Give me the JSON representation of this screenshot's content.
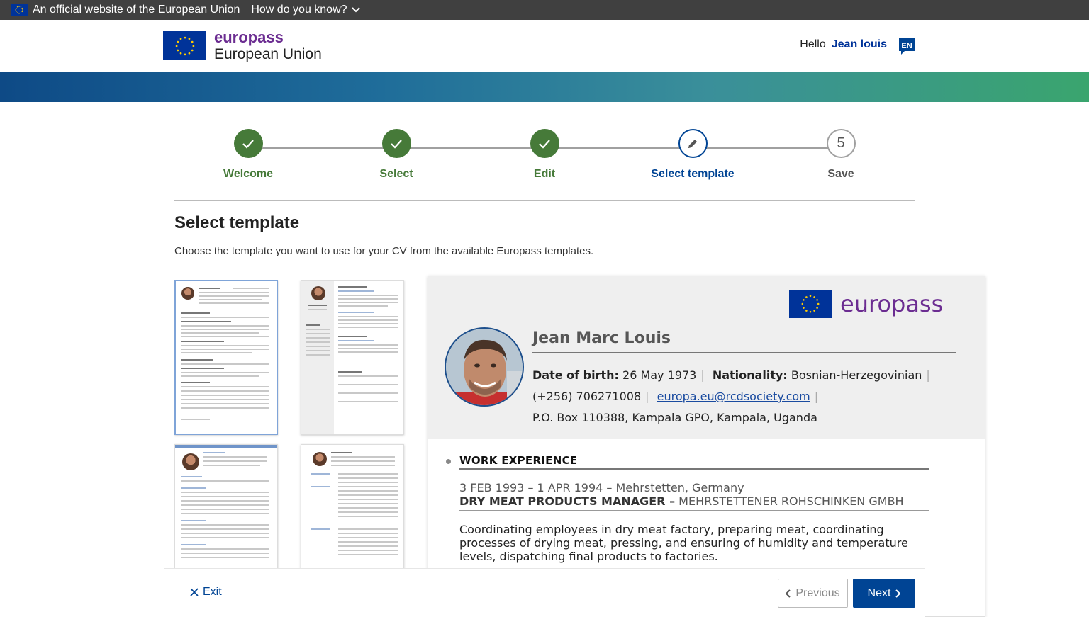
{
  "eu_bar": {
    "official_text": "An official website of the European Union",
    "how_know": "How do you know?"
  },
  "header": {
    "brand": "europass",
    "org": "European Union",
    "greeting": "Hello",
    "user_name": "Jean louis",
    "language": "EN"
  },
  "stepper": {
    "steps": [
      {
        "label": "Welcome",
        "state": "done"
      },
      {
        "label": "Select",
        "state": "done"
      },
      {
        "label": "Edit",
        "state": "done"
      },
      {
        "label": "Select template",
        "state": "current"
      },
      {
        "label": "Save",
        "state": "todo",
        "number": "5"
      }
    ]
  },
  "page": {
    "title": "Select template",
    "intro": "Choose the template you want to use for your CV from the available Europass templates."
  },
  "preview": {
    "brand": "europass",
    "name": "Jean Marc Louis",
    "dob_label": "Date of birth:",
    "dob_value": "26 May 1973",
    "nationality_label": "Nationality:",
    "nationality_value": "Bosnian-Herzegovinian",
    "phone": "(+256) 706271008",
    "email": "europa.eu@rcdsociety.com",
    "address": "P.O. Box 110388, Kampala GPO, Kampala, Uganda",
    "section_title": "WORK EXPERIENCE",
    "job_date": "3 FEB 1993 – 1 APR 1994 – Mehrstetten, Germany",
    "job_title": "DRY MEAT PRODUCTS MANAGER –",
    "job_employer": "MEHRSTETTENER ROHSCHINKEN GMBH",
    "job_desc": "Coordinating employees in dry meat factory, preparing meat, coordinating processes of drying meat, pressing, and ensuring of humidity and temperature levels, dispatching final products to factories."
  },
  "footer": {
    "exit": "Exit",
    "previous": "Previous",
    "next": "Next"
  },
  "colors": {
    "primary": "#004494",
    "done": "#467a39",
    "brand": "#6b2c91",
    "eu_blue": "#003399"
  }
}
